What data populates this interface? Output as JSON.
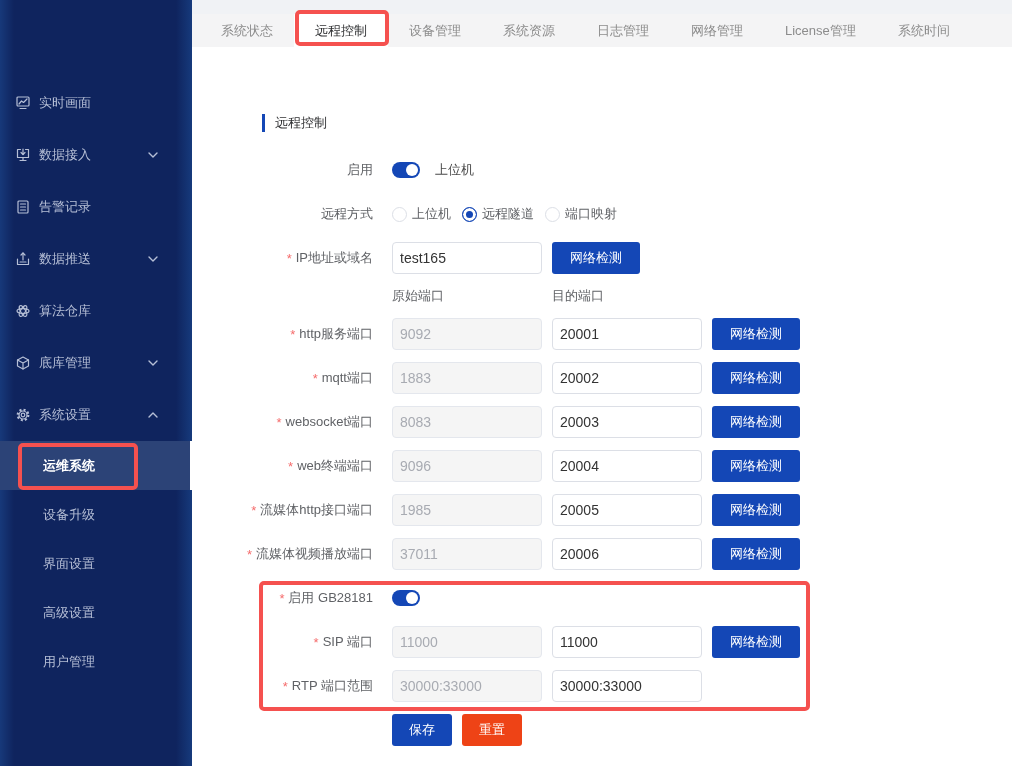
{
  "sidebar": {
    "items": [
      {
        "kind": "link",
        "label": "实时画面",
        "selected": false
      },
      {
        "kind": "group",
        "label": "数据接入",
        "selected": false,
        "expanded": false
      },
      {
        "kind": "link",
        "label": "告警记录",
        "selected": false
      },
      {
        "kind": "group",
        "label": "数据推送",
        "selected": false,
        "expanded": false
      },
      {
        "kind": "link",
        "label": "算法仓库",
        "selected": false
      },
      {
        "kind": "group",
        "label": "底库管理",
        "selected": false,
        "expanded": false
      },
      {
        "kind": "group",
        "label": "系统设置",
        "selected": false,
        "expanded": true,
        "children": [
          {
            "label": "运维系统",
            "selected": true,
            "highlighted": true
          },
          {
            "label": "设备升级",
            "selected": false,
            "highlighted": false
          },
          {
            "label": "界面设置",
            "selected": false,
            "highlighted": false
          },
          {
            "label": "高级设置",
            "selected": false,
            "highlighted": false
          },
          {
            "label": "用户管理",
            "selected": false,
            "highlighted": false
          }
        ]
      }
    ]
  },
  "tabs": [
    {
      "label": "系统状态",
      "selected": false,
      "highlighted": false
    },
    {
      "label": "远程控制",
      "selected": true,
      "highlighted": true
    },
    {
      "label": "设备管理",
      "selected": false,
      "highlighted": false
    },
    {
      "label": "系统资源",
      "selected": false,
      "highlighted": false
    },
    {
      "label": "日志管理",
      "selected": false,
      "highlighted": false
    },
    {
      "label": "网络管理",
      "selected": false,
      "highlighted": false
    },
    {
      "label": "License管理",
      "selected": false,
      "highlighted": false
    },
    {
      "label": "系统时间",
      "selected": false,
      "highlighted": false
    }
  ],
  "form": {
    "title": "远程控制",
    "enable": {
      "label": "启用",
      "on": true,
      "text": "上位机"
    },
    "mode": {
      "label": "远程方式",
      "options": [
        {
          "label": "上位机",
          "selected": false
        },
        {
          "label": "远程隧道",
          "selected": true
        },
        {
          "label": "端口映射",
          "selected": false
        }
      ]
    },
    "host": {
      "mark": "*",
      "label": "IP地址或域名",
      "input": {
        "value": "test165",
        "disabled": false
      },
      "button": "网络检测"
    },
    "port_headers": [
      "原始端口",
      "目的端口"
    ],
    "ports": [
      {
        "mark": "*",
        "label": "http服务端口",
        "source": {
          "value": "9092",
          "disabled": true
        },
        "target": {
          "value": "20001",
          "disabled": false
        },
        "button": "网络检测"
      },
      {
        "mark": "*",
        "label": "mqtt端口",
        "source": {
          "value": "1883",
          "disabled": true
        },
        "target": {
          "value": "20002",
          "disabled": false
        },
        "button": "网络检测"
      },
      {
        "mark": "*",
        "label": "websocket端口",
        "source": {
          "value": "8083",
          "disabled": true
        },
        "target": {
          "value": "20003",
          "disabled": false
        },
        "button": "网络检测"
      },
      {
        "mark": "*",
        "label": "web终端端口",
        "source": {
          "value": "9096",
          "disabled": true
        },
        "target": {
          "value": "20004",
          "disabled": false
        },
        "button": "网络检测"
      },
      {
        "mark": "*",
        "label": "流媒体http接口端口",
        "source": {
          "value": "1985",
          "disabled": true
        },
        "target": {
          "value": "20005",
          "disabled": false
        },
        "button": "网络检测"
      },
      {
        "mark": "*",
        "label": "流媒体视频播放端口",
        "source": {
          "value": "37011",
          "disabled": true
        },
        "target": {
          "value": "20006",
          "disabled": false
        },
        "button": "网络检测"
      }
    ],
    "gb28181": {
      "highlighted": true,
      "enable": {
        "mark": "*",
        "label": "启用 GB28181",
        "on": true
      },
      "ports": [
        {
          "mark": "*",
          "label": "SIP 端口",
          "source": {
            "value": "11000",
            "disabled": true
          },
          "target": {
            "value": "11000",
            "disabled": false
          },
          "button": "网络检测"
        },
        {
          "mark": "*",
          "label": "RTP 端口范围",
          "source": {
            "value": "30000:33000",
            "disabled": true
          },
          "target": {
            "value": "30000:33000",
            "disabled": false
          }
        }
      ]
    },
    "actions": [
      {
        "kind": "primary",
        "label": "保存"
      },
      {
        "kind": "danger",
        "label": "重置"
      }
    ]
  }
}
